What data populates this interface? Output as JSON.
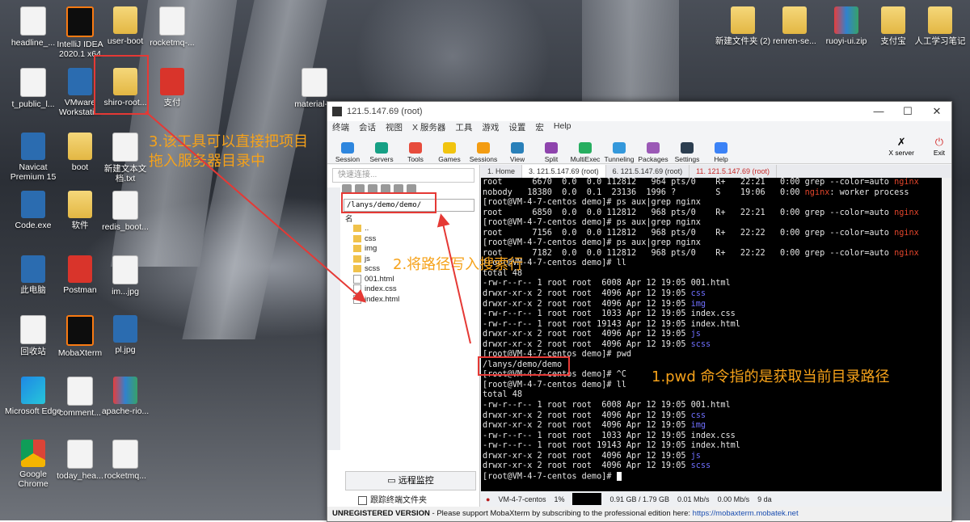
{
  "desktop": {
    "icons": [
      {
        "label": "headline_...",
        "kind": "file"
      },
      {
        "label": "IntelliJ IDEA 2020.1 x64",
        "kind": "idea"
      },
      {
        "label": "user-boot",
        "kind": "folder"
      },
      {
        "label": "rocketmq-...",
        "kind": "file"
      },
      {
        "label": "t_public_l...",
        "kind": "file"
      },
      {
        "label": "VMware Workstati...",
        "kind": "app"
      },
      {
        "label": "shiro-root...",
        "kind": "folder"
      },
      {
        "label": "支付",
        "kind": "red"
      },
      {
        "label": "material-...",
        "kind": "file"
      },
      {
        "label": "Navicat Premium 15",
        "kind": "app"
      },
      {
        "label": "boot",
        "kind": "folder"
      },
      {
        "label": "新建文本文档.txt",
        "kind": "file"
      },
      {
        "label": "Code.exe",
        "kind": "app"
      },
      {
        "label": "软件",
        "kind": "folder"
      },
      {
        "label": "redis_boot...",
        "kind": "file"
      },
      {
        "label": "此电脑",
        "kind": "app"
      },
      {
        "label": "Postman",
        "kind": "red"
      },
      {
        "label": "im...jpg",
        "kind": "file"
      },
      {
        "label": "回收站",
        "kind": "file"
      },
      {
        "label": "MobaXterm",
        "kind": "idea"
      },
      {
        "label": "pl.jpg",
        "kind": "app"
      },
      {
        "label": "Microsoft Edge",
        "kind": "edge"
      },
      {
        "label": "comment...",
        "kind": "file"
      },
      {
        "label": "apache-rio...",
        "kind": "zip"
      },
      {
        "label": "Google Chrome",
        "kind": "chrome"
      },
      {
        "label": "today_hea...",
        "kind": "file"
      },
      {
        "label": "rocketmq...",
        "kind": "file"
      },
      {
        "label": "新建文件夹 (2)",
        "kind": "folder"
      },
      {
        "label": "renren-se...",
        "kind": "folder"
      },
      {
        "label": "ruoyi-ui.zip",
        "kind": "zip"
      },
      {
        "label": "支付宝",
        "kind": "folder"
      },
      {
        "label": "人工学习笔记",
        "kind": "folder"
      }
    ]
  },
  "annotations": {
    "step3_line1": "3.该工具可以直接把项目",
    "step3_line2": "拖入服务器目录中",
    "step2": "2.将路径写入搜索行",
    "step1": "1.pwd 命令指的是获取当前目录路径"
  },
  "window": {
    "title": "121.5.147.69 (root)",
    "menu": [
      "终端",
      "会话",
      "视图",
      "X 服务器",
      "工具",
      "游戏",
      "设置",
      "宏",
      "Help"
    ],
    "toolbar": [
      {
        "label": "Session",
        "color": "#2e86de"
      },
      {
        "label": "Servers",
        "color": "#16a085"
      },
      {
        "label": "Tools",
        "color": "#e74c3c"
      },
      {
        "label": "Games",
        "color": "#f1c40f"
      },
      {
        "label": "Sessions",
        "color": "#f39c12"
      },
      {
        "label": "View",
        "color": "#2980b9"
      },
      {
        "label": "Split",
        "color": "#8e44ad"
      },
      {
        "label": "MultiExec",
        "color": "#27ae60"
      },
      {
        "label": "Tunneling",
        "color": "#3498db"
      },
      {
        "label": "Packages",
        "color": "#9b59b6"
      },
      {
        "label": "Settings",
        "color": "#2c3e50"
      },
      {
        "label": "Help",
        "color": "#3b82f6"
      }
    ],
    "xserver_label": "X server",
    "exit_label": "Exit",
    "quick_connect_placeholder": "快速连接...",
    "path_value": "/lanys/demo/demo/",
    "file_tree": {
      "header": "名",
      "items": [
        {
          "name": "..",
          "kind": "folder"
        },
        {
          "name": "css",
          "kind": "folder"
        },
        {
          "name": "img",
          "kind": "folder"
        },
        {
          "name": "js",
          "kind": "folder"
        },
        {
          "name": "scss",
          "kind": "folder"
        },
        {
          "name": "001.html",
          "kind": "file"
        },
        {
          "name": "index.css",
          "kind": "file"
        },
        {
          "name": "index.html",
          "kind": "file"
        }
      ]
    },
    "remote_monitor": "远程监控",
    "follow_terminal": "跟踪终端文件夹",
    "tabs": [
      {
        "label": "1. Home"
      },
      {
        "label": "3. 121.5.147.69 (root)"
      },
      {
        "label": "6. 121.5.147.69 (root)"
      },
      {
        "label": "11. 121.5.147.69 (root)"
      }
    ],
    "terminal": [
      [
        {
          "t": "root      6670  0.0  0.0 112812   964 pts/0    R+   22:21   0:00 grep --color=auto "
        },
        {
          "t": "nginx",
          "c": "nginx"
        }
      ],
      [
        {
          "t": "nobody   18380  0.0  0.1  23136  1996 ?        S    19:06   0:00 "
        },
        {
          "t": "nginx",
          "c": "nginx"
        },
        {
          "t": ": worker process"
        }
      ],
      [
        {
          "t": "[root@VM-4-7-centos demo]# ps aux|grep nginx"
        }
      ],
      [
        {
          "t": "root      6850  0.0  0.0 112812   968 pts/0    R+   22:21   0:00 grep --color=auto "
        },
        {
          "t": "nginx",
          "c": "nginx"
        }
      ],
      [
        {
          "t": "[root@VM-4-7-centos demo]# ps aux|grep nginx"
        }
      ],
      [
        {
          "t": "root      7156  0.0  0.0 112812   968 pts/0    R+   22:22   0:00 grep --color=auto "
        },
        {
          "t": "nginx",
          "c": "nginx"
        }
      ],
      [
        {
          "t": "[root@VM-4-7-centos demo]# ps aux|grep nginx"
        }
      ],
      [
        {
          "t": "root      7182  0.0  0.0 112812   968 pts/0    R+   22:22   0:00 grep --color=auto "
        },
        {
          "t": "nginx",
          "c": "nginx"
        }
      ],
      [
        {
          "t": "[root@VM-4-7-centos demo]# ll"
        }
      ],
      [
        {
          "t": "total 48"
        }
      ],
      [
        {
          "t": "-rw-r--r-- 1 root root  6008 Apr 12 19:05 001.html"
        }
      ],
      [
        {
          "t": "drwxr-xr-x 2 root root  4096 Apr 12 19:05 "
        },
        {
          "t": "css",
          "c": "dir"
        }
      ],
      [
        {
          "t": "drwxr-xr-x 2 root root  4096 Apr 12 19:05 "
        },
        {
          "t": "img",
          "c": "dir"
        }
      ],
      [
        {
          "t": "-rw-r--r-- 1 root root  1033 Apr 12 19:05 index.css"
        }
      ],
      [
        {
          "t": "-rw-r--r-- 1 root root 19143 Apr 12 19:05 index.html"
        }
      ],
      [
        {
          "t": "drwxr-xr-x 2 root root  4096 Apr 12 19:05 "
        },
        {
          "t": "js",
          "c": "dir"
        }
      ],
      [
        {
          "t": "drwxr-xr-x 2 root root  4096 Apr 12 19:05 "
        },
        {
          "t": "scss",
          "c": "dir"
        }
      ],
      [
        {
          "t": "[root@VM-4-7-centos demo]# pwd"
        }
      ],
      [
        {
          "t": "/lanys/demo/demo"
        }
      ],
      [
        {
          "t": "[root@VM-4-7-centos demo]# ^C"
        }
      ],
      [
        {
          "t": "[root@VM-4-7-centos demo]# ll"
        }
      ],
      [
        {
          "t": "total 48"
        }
      ],
      [
        {
          "t": "-rw-r--r-- 1 root root  6008 Apr 12 19:05 001.html"
        }
      ],
      [
        {
          "t": "drwxr-xr-x 2 root root  4096 Apr 12 19:05 "
        },
        {
          "t": "css",
          "c": "dir"
        }
      ],
      [
        {
          "t": "drwxr-xr-x 2 root root  4096 Apr 12 19:05 "
        },
        {
          "t": "img",
          "c": "dir"
        }
      ],
      [
        {
          "t": "-rw-r--r-- 1 root root  1033 Apr 12 19:05 index.css"
        }
      ],
      [
        {
          "t": "-rw-r--r-- 1 root root 19143 Apr 12 19:05 index.html"
        }
      ],
      [
        {
          "t": "drwxr-xr-x 2 root root  4096 Apr 12 19:05 "
        },
        {
          "t": "js",
          "c": "dir"
        }
      ],
      [
        {
          "t": "drwxr-xr-x 2 root root  4096 Apr 12 19:05 "
        },
        {
          "t": "scss",
          "c": "dir"
        }
      ],
      [
        {
          "t": "[root@VM-4-7-centos demo]# "
        }
      ]
    ],
    "status": {
      "host": "VM-4-7-centos",
      "cpu": "1%",
      "mem": "0.91 GB / 1.79 GB",
      "up": "0.01 Mb/s",
      "down": "0.00 Mb/s",
      "days": "9 da"
    },
    "footer": {
      "unregistered": "UNREGISTERED VERSION",
      "message": " -  Please support MobaXterm by subscribing to the professional edition here:  ",
      "link": "https://mobaxterm.mobatek.net"
    }
  },
  "colors": {
    "annotation": "#f6a21a",
    "highlight_box": "#e53935",
    "nginx": "#e2452b",
    "dir": "#6f6fff"
  }
}
